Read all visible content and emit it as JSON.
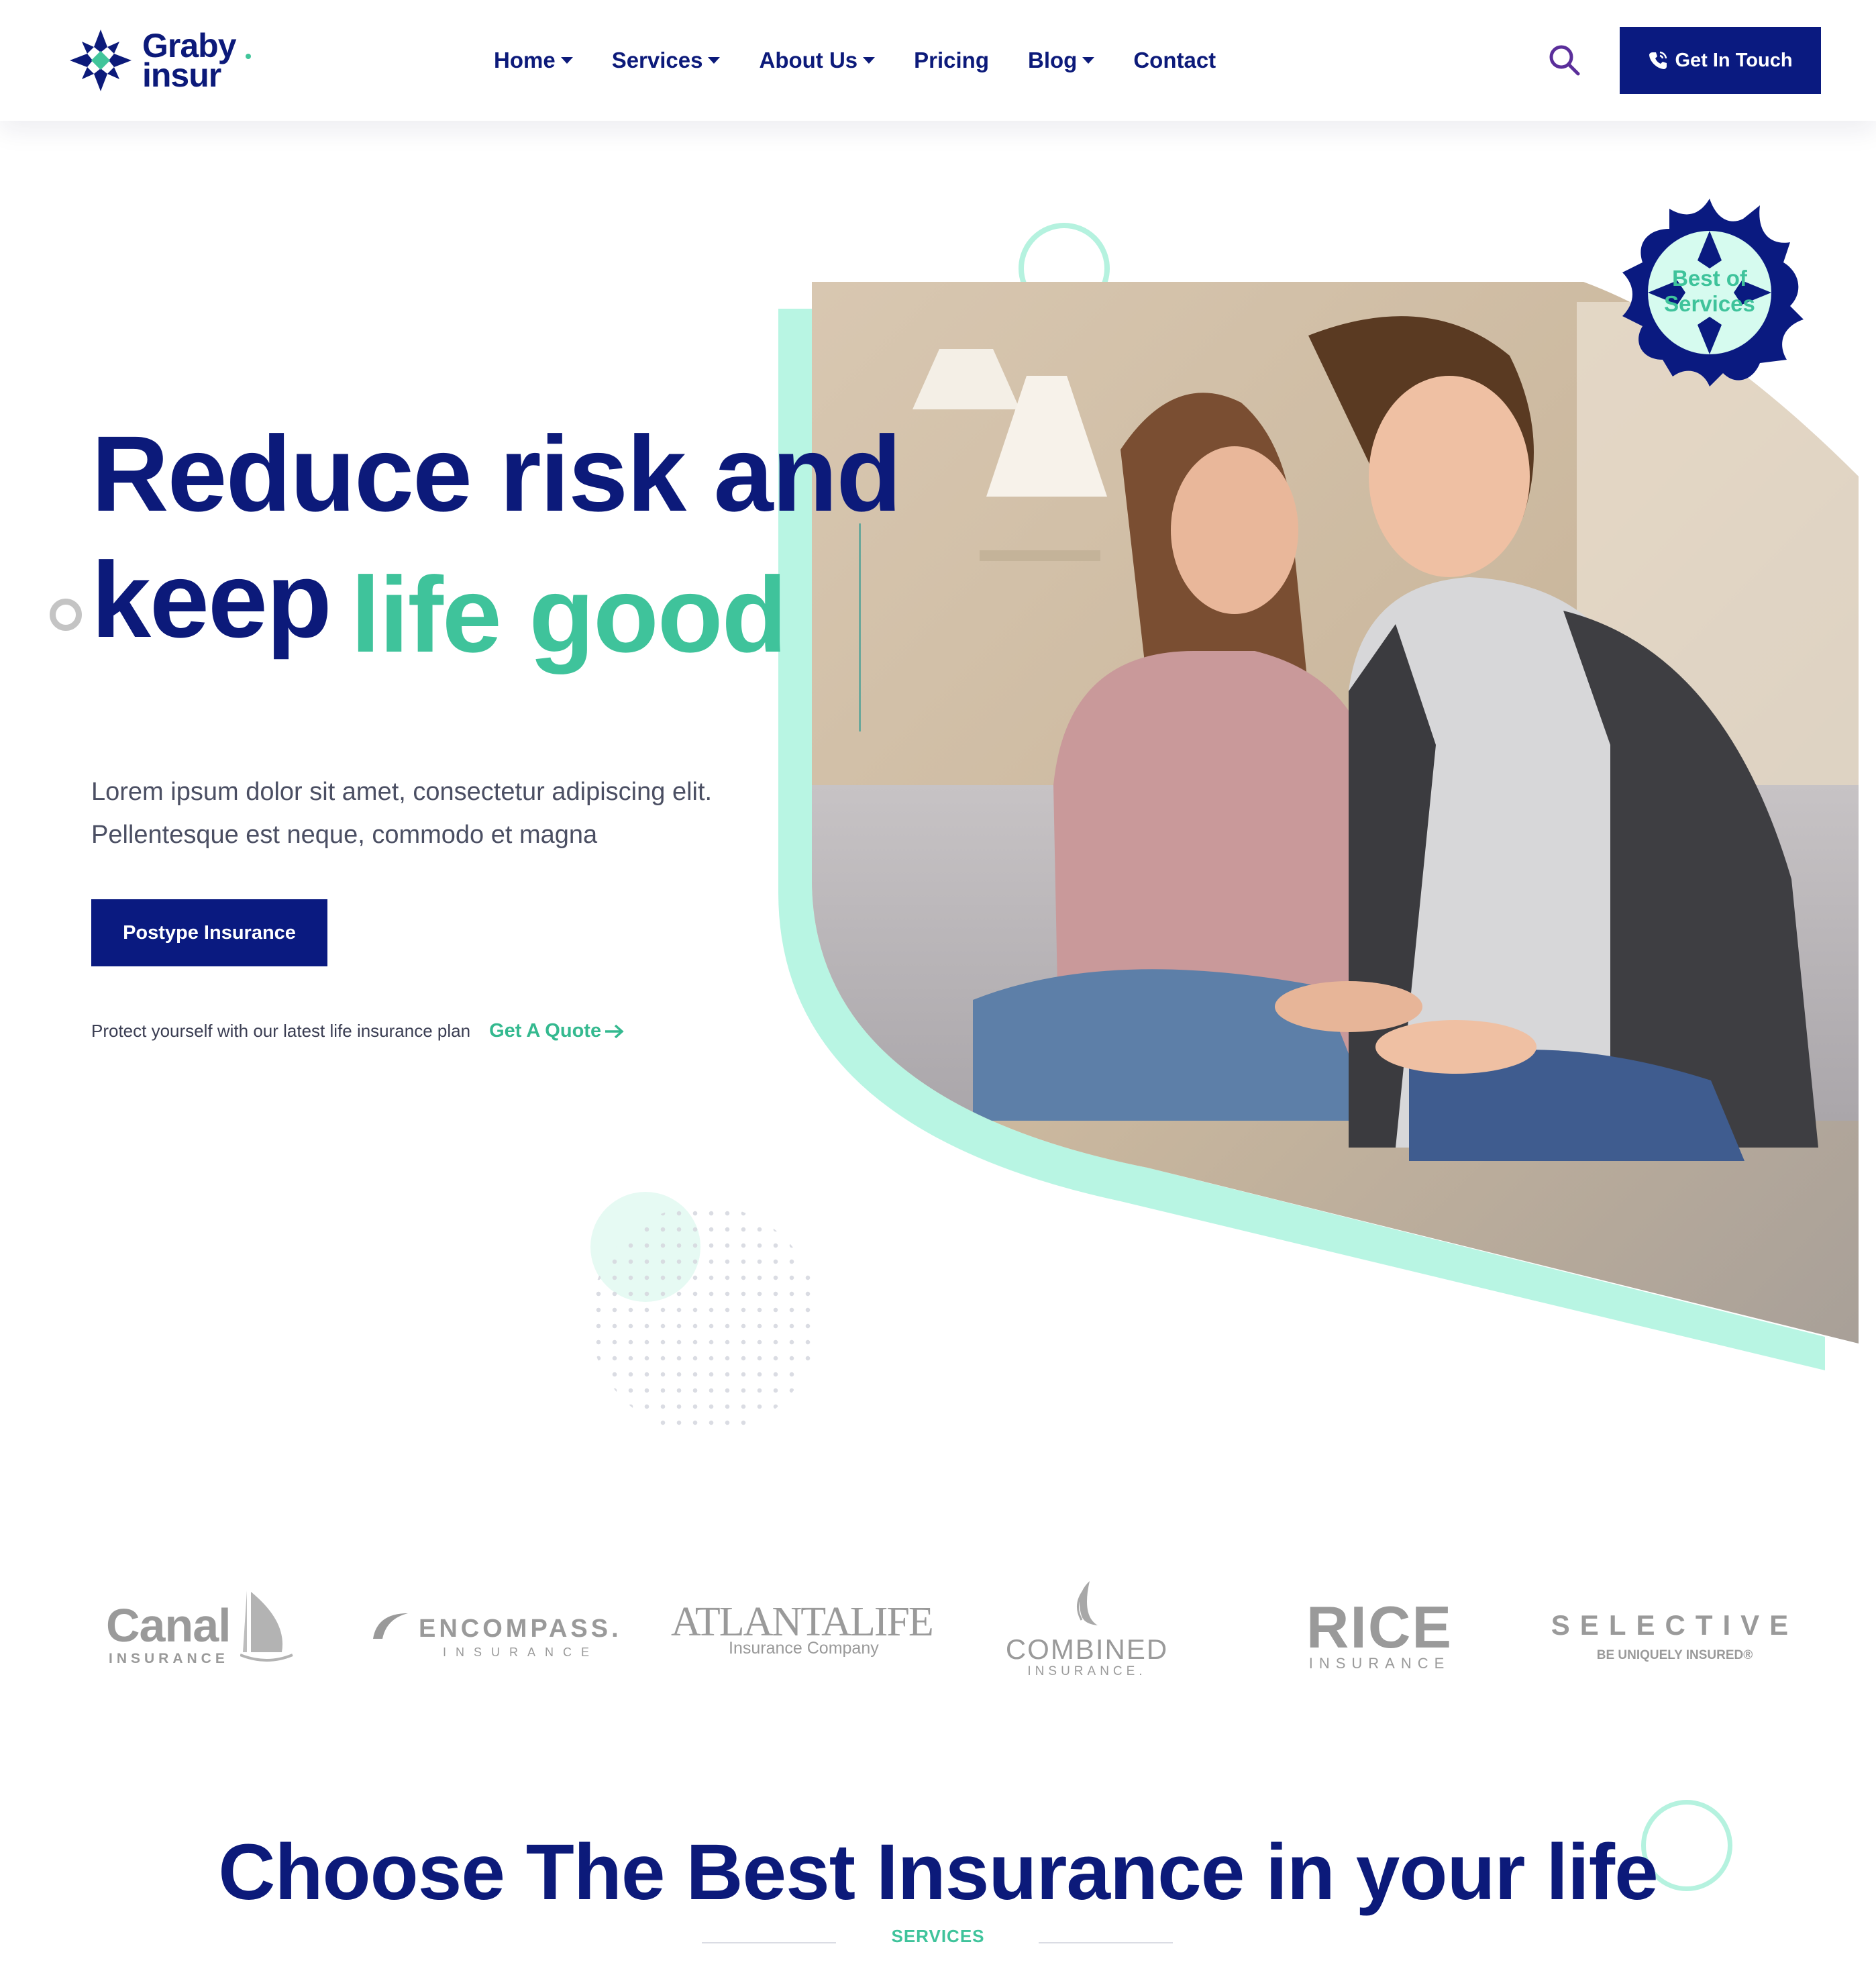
{
  "header": {
    "logo": {
      "line1": "Graby",
      "line2": "insur"
    },
    "nav": [
      {
        "label": "Home",
        "dropdown": true
      },
      {
        "label": "Services",
        "dropdown": true
      },
      {
        "label": "About Us",
        "dropdown": true
      },
      {
        "label": "Pricing",
        "dropdown": false
      },
      {
        "label": "Blog",
        "dropdown": true
      },
      {
        "label": "Contact",
        "dropdown": false
      }
    ],
    "search_icon": "search-icon",
    "cta_label": "Get In Touch",
    "cta_icon": "phone-icon"
  },
  "hero": {
    "headline_line1": "Reduce risk and",
    "headline_line2_part1": "keep",
    "headline_line2_accent": "life good",
    "description_line1": "Lorem ipsum dolor sit amet, consectetur adipiscing elit.",
    "description_line2": "Pellentesque est neque, commodo et magna",
    "primary_button": "Postype Insurance",
    "protect_text": "Protect yourself with our latest life insurance plan",
    "quote_link": "Get A Quote",
    "badge_line1": "Best of",
    "badge_line2": "Services"
  },
  "partners": {
    "canal": {
      "name": "Canal",
      "sub": "INSURANCE"
    },
    "encompass": {
      "name": "ENCOMPASS.",
      "sub": "INSURANCE"
    },
    "atlantalife": {
      "name": "ATLANTALIFE",
      "sub": "Insurance Company"
    },
    "combined": {
      "name": "COMBINED",
      "sub": "INSURANCE."
    },
    "rice": {
      "name": "RICE",
      "sub": "INSURANCE"
    },
    "selective": {
      "name": "SELECTIVE",
      "sub": "BE UNIQUELY INSURED®"
    }
  },
  "section": {
    "heading": "Choose The Best Insurance in your life",
    "label": "SERVICES"
  },
  "colors": {
    "navy": "#0a1a80",
    "mint": "#3fc39b",
    "mint_light": "#b8f5e3",
    "partner_gray": "#9a9a9a"
  }
}
